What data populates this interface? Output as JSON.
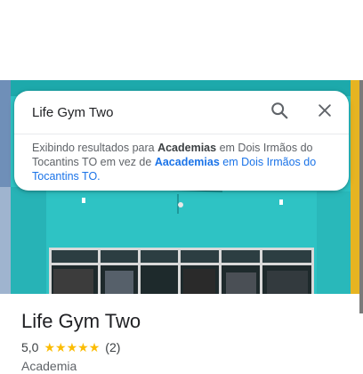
{
  "search": {
    "query": "Life Gym Two",
    "suggestion": {
      "prefix": "Exibindo resultados para",
      "term": "Academias",
      "middle": "em Dois Irmãos do Tocantins TO em vez de",
      "alt_term": "Aacademias",
      "alt_rest": "em Dois Irmãos do Tocantins TO."
    }
  },
  "place": {
    "name": "Life Gym Two",
    "rating": "5,0",
    "stars": 5,
    "reviews": "(2)",
    "category": "Academia"
  },
  "colors": {
    "accent": "#1a73e8",
    "star": "#fbbc04",
    "building": "#2ec3c4"
  },
  "icons": {
    "search": "search-icon",
    "close": "close-icon",
    "star": "star-icon"
  }
}
